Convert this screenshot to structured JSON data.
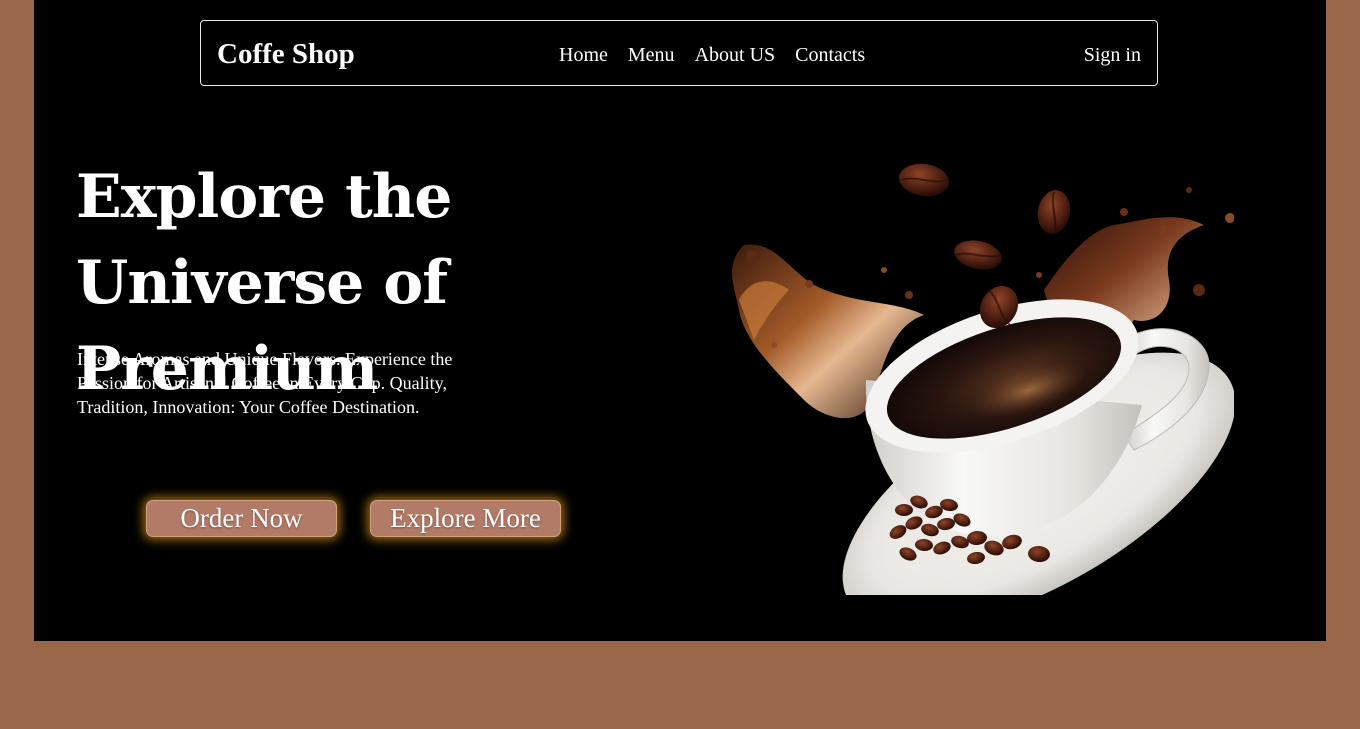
{
  "navbar": {
    "brand": "Coffe Shop",
    "links": [
      "Home",
      "Menu",
      "About US",
      "Contacts"
    ],
    "sign_in": "Sign in"
  },
  "hero": {
    "headline": "Explore the Universe of Premium",
    "subtext": "Intense Aromas and Unique Flavors. Experience the Passion for Artisanal Coffee in Every Cup. Quality, Tradition, Innovation: Your Coffee Destination.",
    "buttons": {
      "order": "Order Now",
      "explore": "Explore More"
    }
  },
  "colors": {
    "page_background": "#9a6849",
    "hero_background": "#000000",
    "button": "#b27b68",
    "button_glow": "#ffae23"
  },
  "icons": {
    "hero_image": "coffee-cup-splash-image"
  }
}
